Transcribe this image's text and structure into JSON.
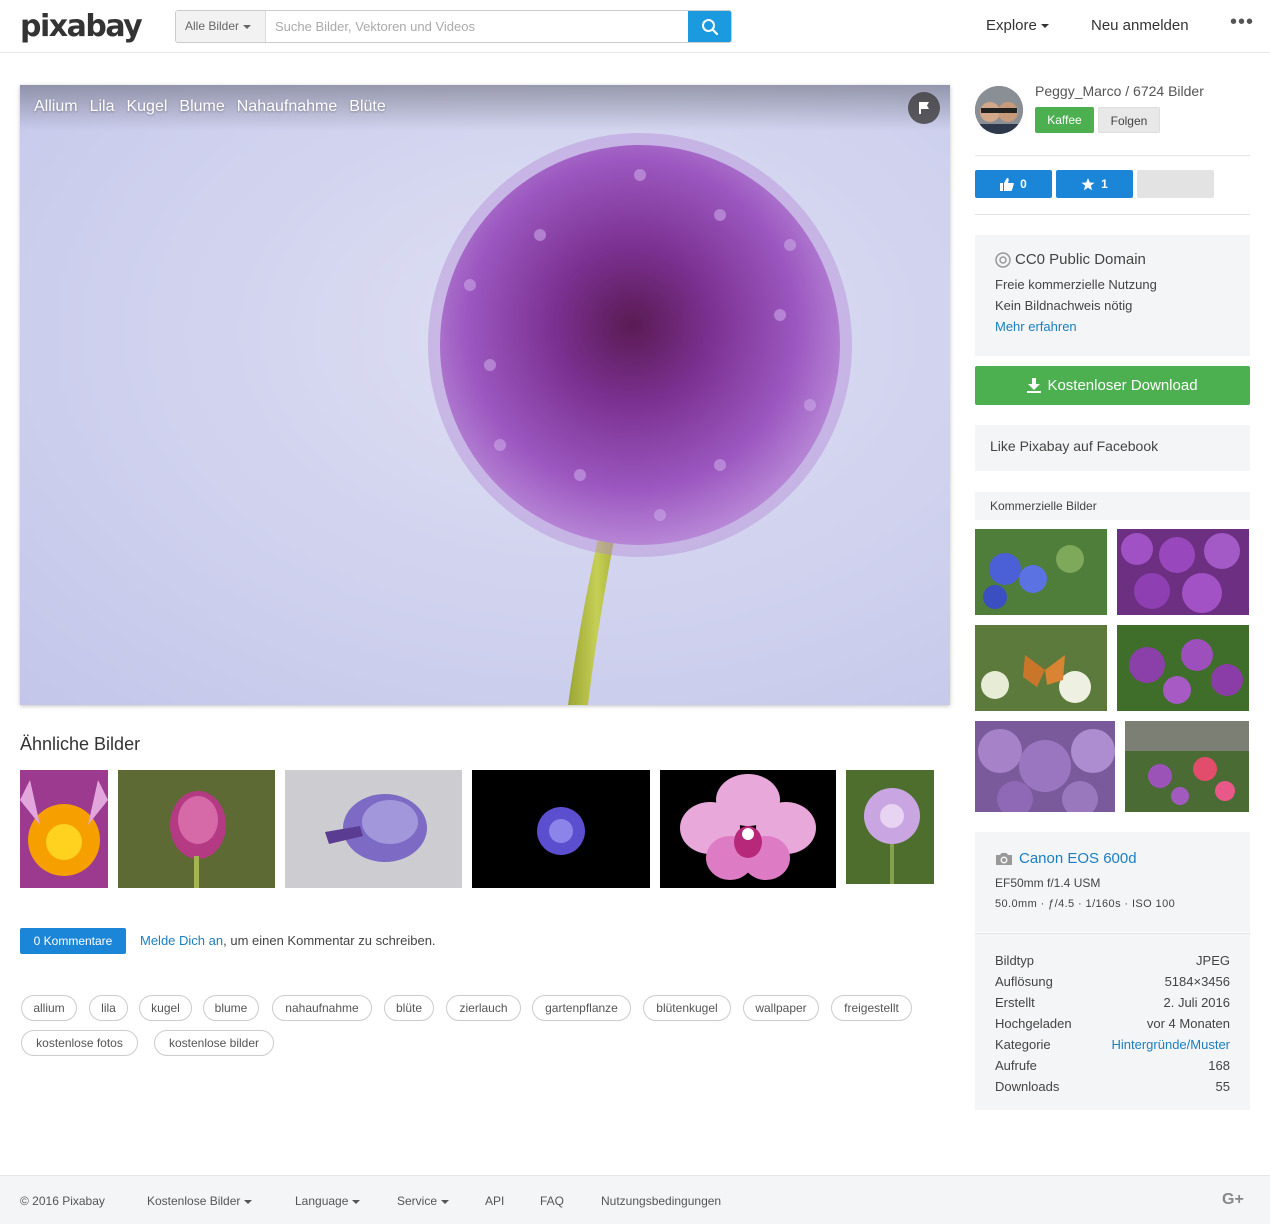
{
  "header": {
    "logo": "pixabay",
    "search_filter": "Alle Bilder",
    "search_placeholder": "Suche Bilder, Vektoren und Videos",
    "nav_explore": "Explore",
    "nav_login": "Neu anmelden",
    "nav_more": "•••"
  },
  "image": {
    "tags": [
      "Allium",
      "Lila",
      "Kugel",
      "Blume",
      "Nahaufnahme",
      "Blüte"
    ]
  },
  "similar": {
    "title": "Ähnliche Bilder"
  },
  "comments": {
    "button": "0 Kommentare",
    "login_link": "Melde Dich an",
    "text": ", um einen Kommentar zu schreiben."
  },
  "tags": [
    "allium",
    "lila",
    "kugel",
    "blume",
    "nahaufnahme",
    "blüte",
    "zierlauch",
    "gartenpflanze",
    "blütenkugel",
    "wallpaper",
    "freigestellt",
    "kostenlose fotos",
    "kostenlose bilder"
  ],
  "user": {
    "line": "Peggy_Marco / 6724 Bilder",
    "coffee": "Kaffee",
    "follow": "Folgen"
  },
  "actions": {
    "likes": "0",
    "favorites": "1"
  },
  "license": {
    "title": "CC0 Public Domain",
    "line1": "Freie kommerzielle Nutzung",
    "line2": "Kein Bildnachweis nötig",
    "more": "Mehr erfahren"
  },
  "download": {
    "label": "Kostenloser Download"
  },
  "facebook": {
    "label": "Like Pixabay auf Facebook"
  },
  "commercial": {
    "title": "Kommerzielle Bilder"
  },
  "camera": {
    "model": "Canon EOS 600d",
    "lens": "EF50mm f/1.4 USM",
    "exif": "50.0mm · ƒ/4.5 · 1/160s · ISO 100"
  },
  "details": [
    {
      "label": "Bildtyp",
      "value": "JPEG"
    },
    {
      "label": "Auflösung",
      "value": "5184×3456"
    },
    {
      "label": "Erstellt",
      "value": "2. Juli 2016"
    },
    {
      "label": "Hochgeladen",
      "value": "vor 4 Monaten"
    },
    {
      "label": "Kategorie",
      "value": "Hintergründe/Muster"
    },
    {
      "label": "Aufrufe",
      "value": "168"
    },
    {
      "label": "Downloads",
      "value": "55"
    }
  ],
  "footer": {
    "copyright": "© 2016 Pixabay",
    "free_images": "Kostenlose Bilder",
    "language": "Language",
    "service": "Service",
    "api": "API",
    "faq": "FAQ",
    "terms": "Nutzungsbedingungen"
  }
}
